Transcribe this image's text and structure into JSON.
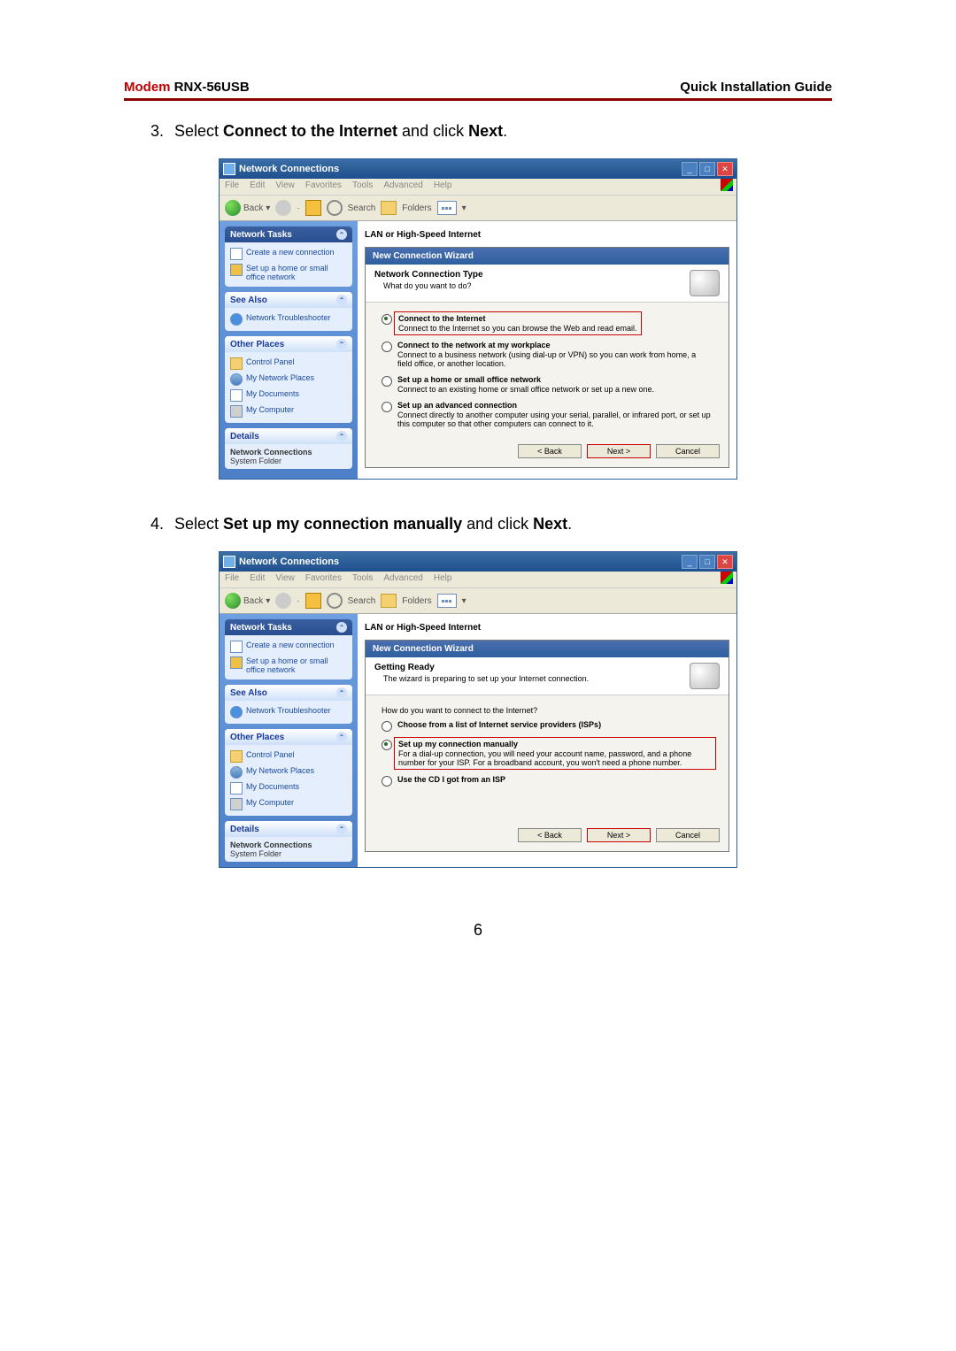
{
  "header": {
    "brand_prefix": "Modem",
    "brand_model": "RNX-56USB",
    "guide": "Quick  Installation  Guide"
  },
  "steps": {
    "s3": {
      "num": "3.",
      "pre": "Select ",
      "bold": "Connect to the Internet",
      "mid": " and click ",
      "bold2": "Next",
      "post": "."
    },
    "s4": {
      "num": "4.",
      "pre": "Select ",
      "bold": "Set up my connection manually",
      "mid": " and click ",
      "bold2": "Next",
      "post": "."
    }
  },
  "win": {
    "title": "Network Connections",
    "menu": [
      "File",
      "Edit",
      "View",
      "Favorites",
      "Tools",
      "Advanced",
      "Help"
    ],
    "toolbar": {
      "back": "Back",
      "search": "Search",
      "folders": "Folders"
    },
    "sidebar": {
      "tasks_title": "Network Tasks",
      "tasks": [
        "Create a new connection",
        "Set up a home or small office network"
      ],
      "see_also_title": "See Also",
      "see_also": [
        "Network Troubleshooter"
      ],
      "other_title": "Other Places",
      "other": [
        "Control Panel",
        "My Network Places",
        "My Documents",
        "My Computer"
      ],
      "details_title": "Details",
      "details_name": "Network Connections",
      "details_type": "System Folder"
    },
    "category": "LAN or High-Speed Internet"
  },
  "wizard1": {
    "title": "New Connection Wizard",
    "head_title": "Network Connection Type",
    "head_sub": "What do you want to do?",
    "options": [
      {
        "title": "Connect to the Internet",
        "desc": "Connect to the Internet so you can browse the Web and read email.",
        "checked": true,
        "highlight": true
      },
      {
        "title": "Connect to the network at my workplace",
        "desc": "Connect to a business network (using dial-up or VPN) so you can work from home, a field office, or another location.",
        "checked": false,
        "highlight": false
      },
      {
        "title": "Set up a home or small office network",
        "desc": "Connect to an existing home or small office network or set up a new one.",
        "checked": false,
        "highlight": false
      },
      {
        "title": "Set up an advanced connection",
        "desc": "Connect directly to another computer using your serial, parallel, or infrared port, or set up this computer so that other computers can connect to it.",
        "checked": false,
        "highlight": false
      }
    ],
    "back": "< Back",
    "next": "Next >",
    "cancel": "Cancel"
  },
  "wizard2": {
    "title": "New Connection Wizard",
    "head_title": "Getting Ready",
    "head_sub": "The wizard is preparing to set up your Internet connection.",
    "question": "How do you want to connect to the Internet?",
    "options": [
      {
        "title": "Choose from a list of Internet service providers (ISPs)",
        "desc": "",
        "checked": false,
        "highlight": false
      },
      {
        "title": "Set up my connection manually",
        "desc": "For a dial-up connection, you will need your account name, password, and a phone number for your ISP. For a broadband account, you won't need a phone number.",
        "checked": true,
        "highlight": true
      },
      {
        "title": "Use the CD I got from an ISP",
        "desc": "",
        "checked": false,
        "highlight": false
      }
    ],
    "back": "< Back",
    "next": "Next >",
    "cancel": "Cancel"
  },
  "page_number": "6"
}
